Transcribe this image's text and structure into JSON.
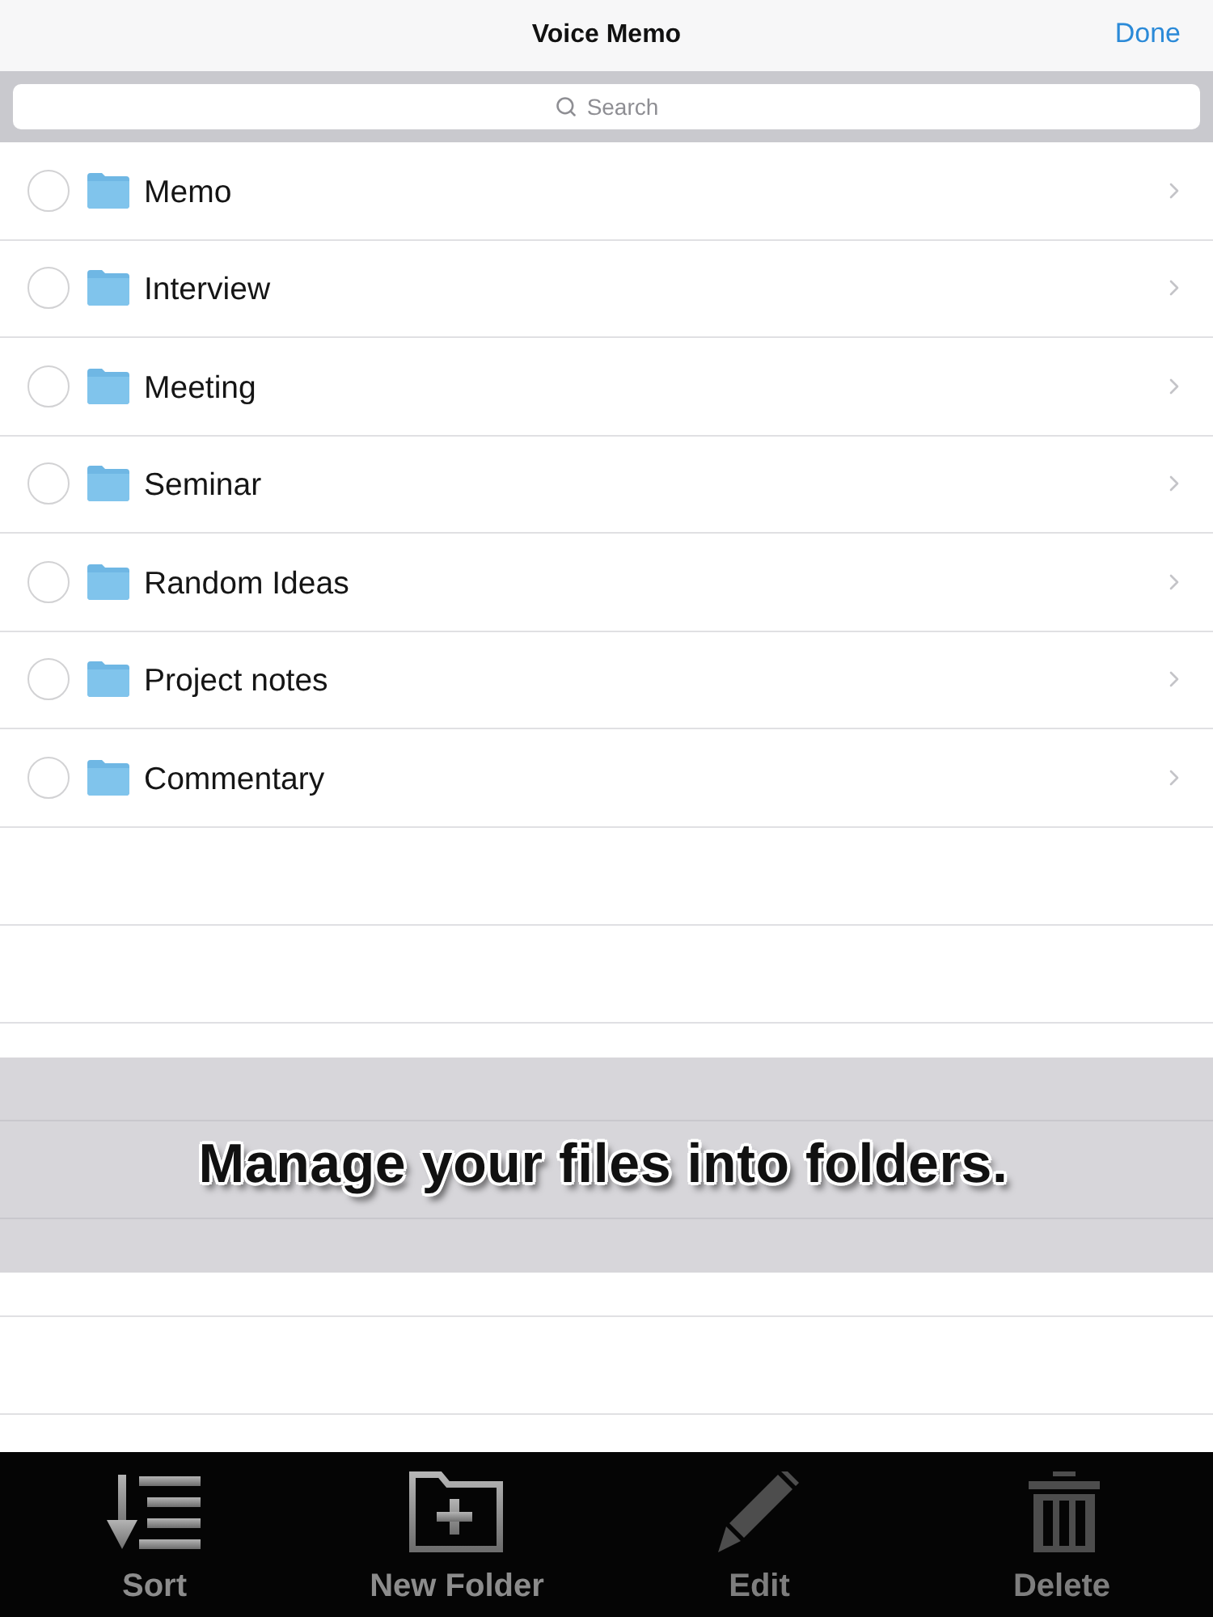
{
  "nav_bar": {
    "title": "Voice Memo",
    "done_button": "Done"
  },
  "search": {
    "placeholder": "Search"
  },
  "folders": [
    {
      "name": "Memo",
      "selected": false
    },
    {
      "name": "Interview",
      "selected": false
    },
    {
      "name": "Meeting",
      "selected": false
    },
    {
      "name": "Seminar",
      "selected": false
    },
    {
      "name": "Random Ideas",
      "selected": false
    },
    {
      "name": "Project notes",
      "selected": false
    },
    {
      "name": "Commentary",
      "selected": false
    }
  ],
  "caption": "Manage your files into folders.",
  "toolbar": [
    {
      "kind": "sort",
      "label": "Sort",
      "disabled": false
    },
    {
      "kind": "new_folder",
      "label": "New Folder",
      "disabled": false
    },
    {
      "kind": "edit",
      "label": "Edit",
      "disabled": true
    },
    {
      "kind": "delete",
      "label": "Delete",
      "disabled": true
    }
  ]
}
